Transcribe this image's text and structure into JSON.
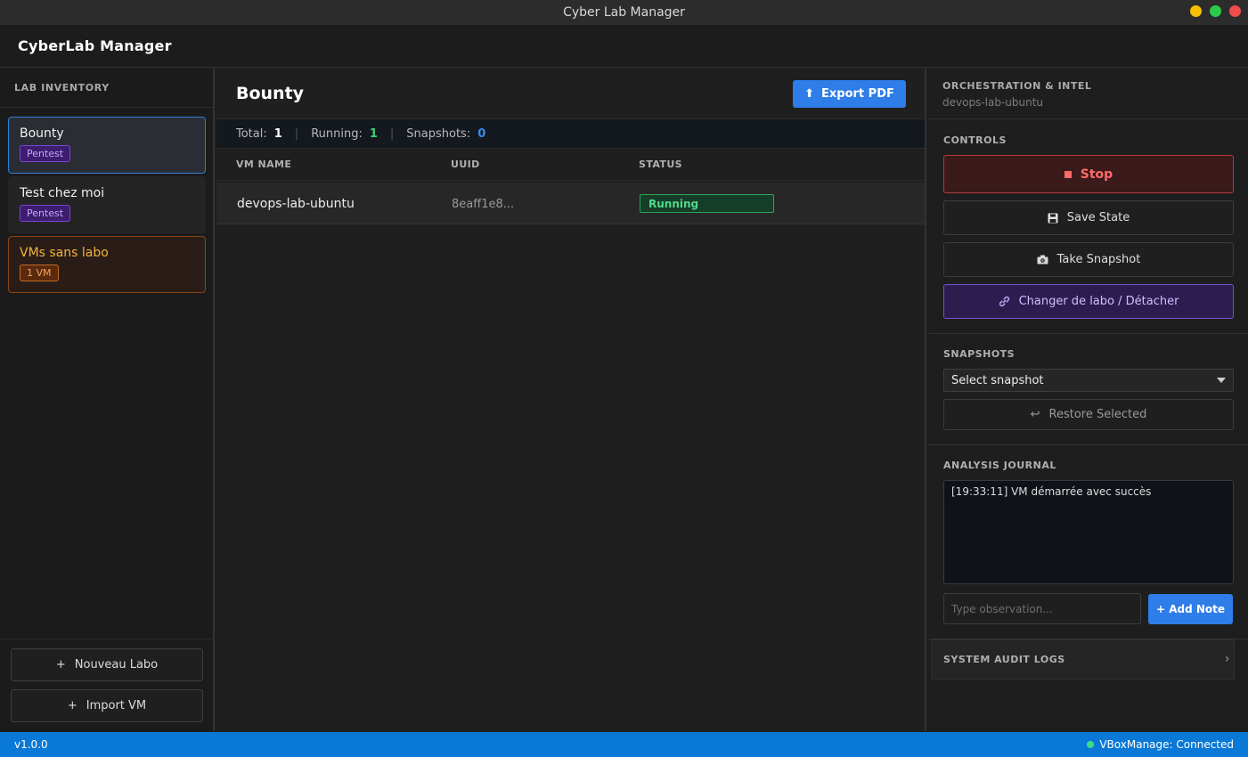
{
  "window": {
    "title": "Cyber Lab Manager"
  },
  "app": {
    "brand": "CyberLab Manager"
  },
  "sidebar": {
    "section_title": "LAB INVENTORY",
    "labs": [
      {
        "name": "Bounty",
        "tag": "Pentest"
      },
      {
        "name": "Test chez moi",
        "tag": "Pentest"
      },
      {
        "name": "VMs sans labo",
        "tag": "1 VM"
      }
    ],
    "new_lab_icon": "+",
    "new_lab_label": "Nouveau Labo",
    "import_icon": "+",
    "import_label": "Import VM"
  },
  "main": {
    "title": "Bounty",
    "export_icon": "⬆",
    "export_label": "Export PDF",
    "stats": {
      "total_label": "Total:",
      "total_value": "1",
      "running_label": "Running:",
      "running_value": "1",
      "snapshots_label": "Snapshots:",
      "snapshots_value": "0",
      "separator": "|"
    },
    "table": {
      "columns": [
        "VM NAME",
        "UUID",
        "STATUS"
      ],
      "rows": [
        {
          "name": "devops-lab-ubuntu",
          "uuid": "8eaff1e8...",
          "status": "Running"
        }
      ]
    }
  },
  "right": {
    "title": "ORCHESTRATION & INTEL",
    "subtitle": "devops-lab-ubuntu",
    "controls_label": "CONTROLS",
    "stop_label": "Stop",
    "save_label": "Save State",
    "snapshot_label": "Take Snapshot",
    "move_label": "Changer de labo / Détacher",
    "snapshots_label": "SNAPSHOTS",
    "select_value": "Select snapshot",
    "restore_icon": "↩",
    "restore_label": "Restore Selected",
    "journal_label": "ANALYSIS JOURNAL",
    "journal_entries": [
      "[19:33:11] VM démarrée avec succès"
    ],
    "note_placeholder": "Type observation...",
    "add_note_label": "+ Add Note",
    "audit_label": "SYSTEM AUDIT LOGS",
    "audit_chevron": "›"
  },
  "statusbar": {
    "version": "v1.0.0",
    "connection": "VBoxManage: Connected"
  },
  "colors": {
    "accent": "#2f7de8",
    "running": "#3ed07a",
    "stop": "#ff6b6b",
    "purple": "#7a4fd4",
    "statusbar": "#0a78d6"
  }
}
